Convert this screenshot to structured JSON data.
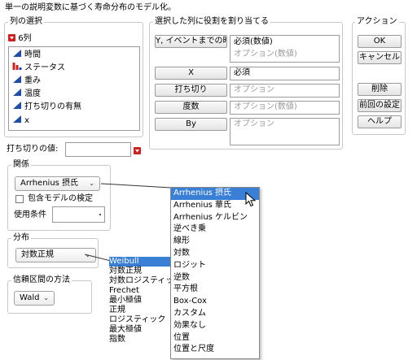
{
  "window": {
    "title": "単一の説明変数に基づく寿命分布のモデル化。"
  },
  "columns": {
    "title": "列の選択",
    "count_label": "6列",
    "items": [
      {
        "label": "時間",
        "icon": "continuous-icon"
      },
      {
        "label": "ステータス",
        "icon": "nominal-icon"
      },
      {
        "label": "重み",
        "icon": "continuous-icon"
      },
      {
        "label": "温度",
        "icon": "continuous-icon"
      },
      {
        "label": "打ち切りの有無",
        "icon": "continuous-icon"
      },
      {
        "label": "x",
        "icon": "continuous-icon"
      }
    ],
    "colors": {
      "continuous": "#1f4fa3",
      "nominal_red": "#d02020",
      "nominal_blue": "#2040c0"
    }
  },
  "roles": {
    "title": "選択した列に役割を割り当てる",
    "y_button": "Y, イベントまでの時間",
    "y_value": "必須(数値)",
    "y_optional": "オプション(数値)",
    "x_button": "X",
    "x_value": "必須",
    "censor_button": "打ち切り",
    "censor_value": "オプション",
    "freq_button": "度数",
    "freq_value": "オプション(数値)",
    "by_button": "By",
    "by_value": "オプション"
  },
  "actions": {
    "title": "アクション",
    "ok": "OK",
    "cancel": "キャンセル",
    "remove": "削除",
    "recall": "前回の設定",
    "help": "ヘルプ"
  },
  "censor_code": {
    "label": "打ち切りの値:",
    "value": ""
  },
  "relationship": {
    "title": "関係",
    "selected": "Arrhenius 摂氏",
    "nested_test_label": "包含モデルの検定",
    "nested_test_checked": false,
    "use_condition_label": "使用条件",
    "use_condition_value": "",
    "options": [
      "Arrhenius 摂氏",
      "Arrhenius 華氏",
      "Arrhenius ケルビン",
      "逆べき乗",
      "線形",
      "対数",
      "ロジット",
      "逆数",
      "平方根",
      "Box-Cox",
      "カスタム",
      "効果なし",
      "位置",
      "位置と尺度"
    ],
    "highlighted_option": "Arrhenius 摂氏"
  },
  "distribution": {
    "title": "分布",
    "selected": "対数正規",
    "options": [
      "Weibull",
      "対数正規",
      "対数ロジスティック",
      "Frechet",
      "最小極値",
      "正規",
      "ロジスティック",
      "最大極値",
      "指数"
    ],
    "highlighted_option": "Weibull"
  },
  "confidence": {
    "title": "信頼区間の方法",
    "selected": "Wald"
  },
  "colors": {
    "selection": "#3a7fd6",
    "group_border": "#c8c8c8",
    "required_marker": "#d02020"
  }
}
